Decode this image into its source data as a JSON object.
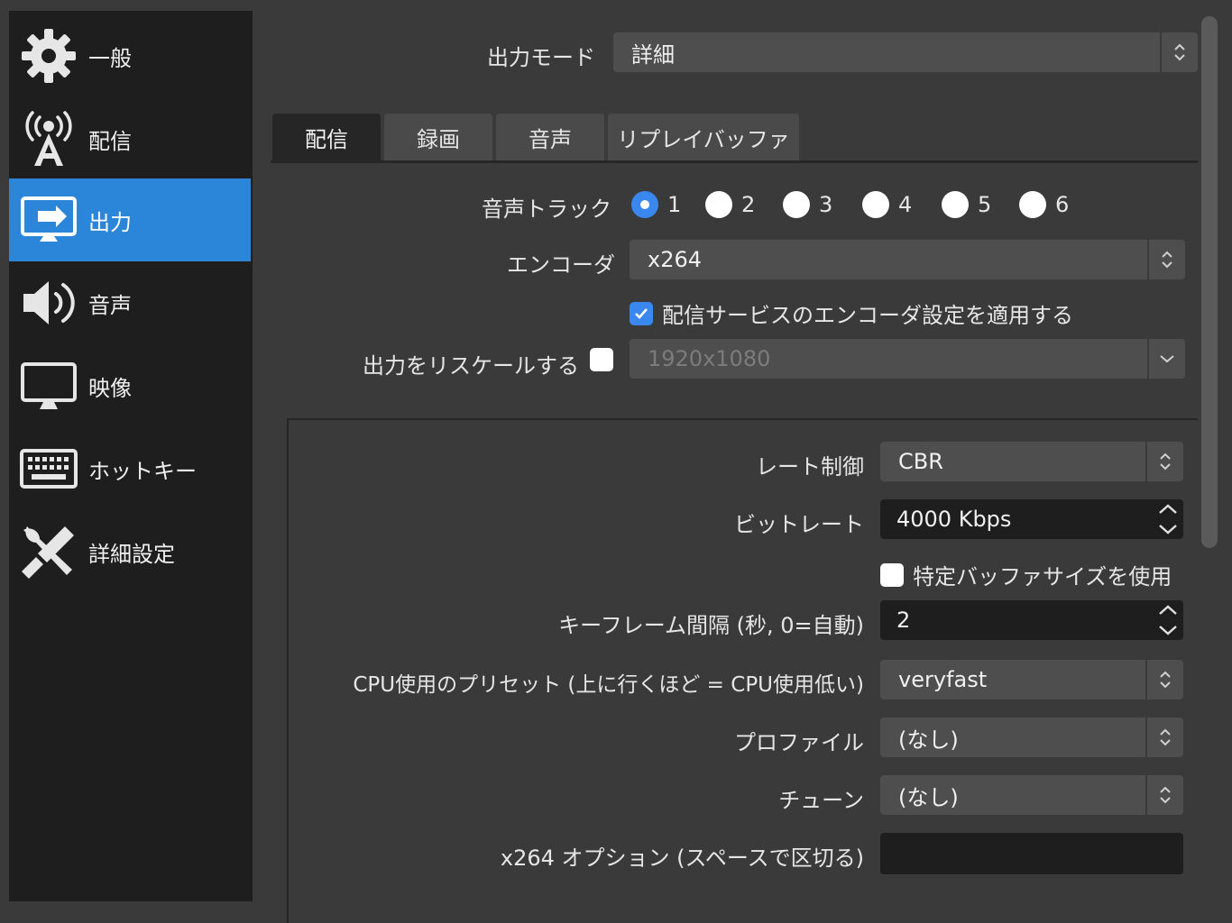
{
  "sidebar": {
    "items": [
      {
        "label": "一般",
        "icon": "gear-icon"
      },
      {
        "label": "配信",
        "icon": "broadcast-antenna-icon"
      },
      {
        "label": "出力",
        "icon": "monitor-output-icon",
        "active": true
      },
      {
        "label": "音声",
        "icon": "speaker-icon"
      },
      {
        "label": "映像",
        "icon": "monitor-icon"
      },
      {
        "label": "ホットキー",
        "icon": "keyboard-icon"
      },
      {
        "label": "詳細設定",
        "icon": "tools-icon"
      }
    ]
  },
  "output_mode": {
    "label": "出力モード",
    "value": "詳細"
  },
  "tabs": [
    {
      "label": "配信",
      "active": true
    },
    {
      "label": "録画"
    },
    {
      "label": "音声"
    },
    {
      "label": "リプレイバッファ"
    }
  ],
  "audio_track": {
    "label": "音声トラック",
    "options": [
      "1",
      "2",
      "3",
      "4",
      "5",
      "6"
    ],
    "selected": "1"
  },
  "encoder": {
    "label": "エンコーダ",
    "value": "x264"
  },
  "apply_service_settings": {
    "label": "配信サービスのエンコーダ設定を適用する",
    "checked": true
  },
  "rescale": {
    "label": "出力をリスケールする",
    "checked": false,
    "value": "1920x1080"
  },
  "rate_control": {
    "label": "レート制御",
    "value": "CBR"
  },
  "bitrate": {
    "label": "ビットレート",
    "value": "4000 Kbps"
  },
  "custom_buffer": {
    "label": "特定バッファサイズを使用",
    "checked": false
  },
  "keyframe": {
    "label": "キーフレーム間隔 (秒, 0=自動)",
    "value": "2"
  },
  "cpu_preset": {
    "label": "CPU使用のプリセット (上に行くほど = CPU使用低い)",
    "value": "veryfast"
  },
  "profile": {
    "label": "プロファイル",
    "value": "(なし)"
  },
  "tune": {
    "label": "チューン",
    "value": "(なし)"
  },
  "x264_options": {
    "label": "x264 オプション (スペースで区切る)",
    "value": ""
  },
  "colors": {
    "accent": "#2b86d9",
    "checkbox": "#3b87f0",
    "sidebar_bg": "#1e1e1e",
    "panel_bg": "#3a3a3a"
  }
}
